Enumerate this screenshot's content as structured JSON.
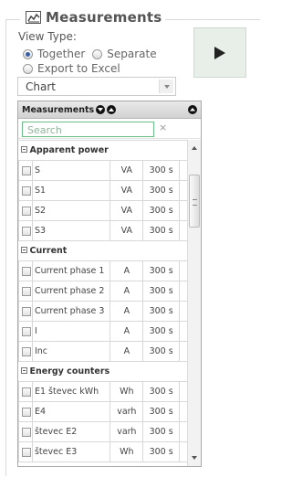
{
  "header": {
    "title": "Measurements",
    "icon": "area-chart-icon"
  },
  "view_type": {
    "label": "View Type:",
    "options": [
      {
        "label": "Together",
        "checked": true
      },
      {
        "label": "Separate",
        "checked": false
      },
      {
        "label": "Export to Excel",
        "checked": false
      }
    ]
  },
  "run_button": {
    "icon": "play-icon"
  },
  "chart_select": {
    "value": "Chart"
  },
  "panel": {
    "title": "Measurements",
    "search_placeholder": "Search",
    "clear": "×",
    "groups": [
      {
        "name": "Apparent power",
        "rows": [
          {
            "name": "S",
            "unit": "VA",
            "period": "300 s"
          },
          {
            "name": "S1",
            "unit": "VA",
            "period": "300 s"
          },
          {
            "name": "S2",
            "unit": "VA",
            "period": "300 s"
          },
          {
            "name": "S3",
            "unit": "VA",
            "period": "300 s"
          }
        ]
      },
      {
        "name": "Current",
        "rows": [
          {
            "name": "Current phase 1",
            "unit": "A",
            "period": "300 s"
          },
          {
            "name": "Current phase 2",
            "unit": "A",
            "period": "300 s"
          },
          {
            "name": "Current phase 3",
            "unit": "A",
            "period": "300 s"
          },
          {
            "name": "I",
            "unit": "A",
            "period": "300 s"
          },
          {
            "name": "Inc",
            "unit": "A",
            "period": "300 s"
          }
        ]
      },
      {
        "name": "Energy counters",
        "rows": [
          {
            "name": "E1 števec kWh",
            "unit": "Wh",
            "period": "300 s"
          },
          {
            "name": "E4",
            "unit": "varh",
            "period": "300 s"
          },
          {
            "name": "števec E2",
            "unit": "varh",
            "period": "300 s"
          },
          {
            "name": "števec E3",
            "unit": "Wh",
            "period": "300 s"
          }
        ]
      }
    ]
  },
  "colors": {
    "accent": "#3a5ea8",
    "search_border": "#6bbf86",
    "play_bg": "#e8efe8"
  }
}
